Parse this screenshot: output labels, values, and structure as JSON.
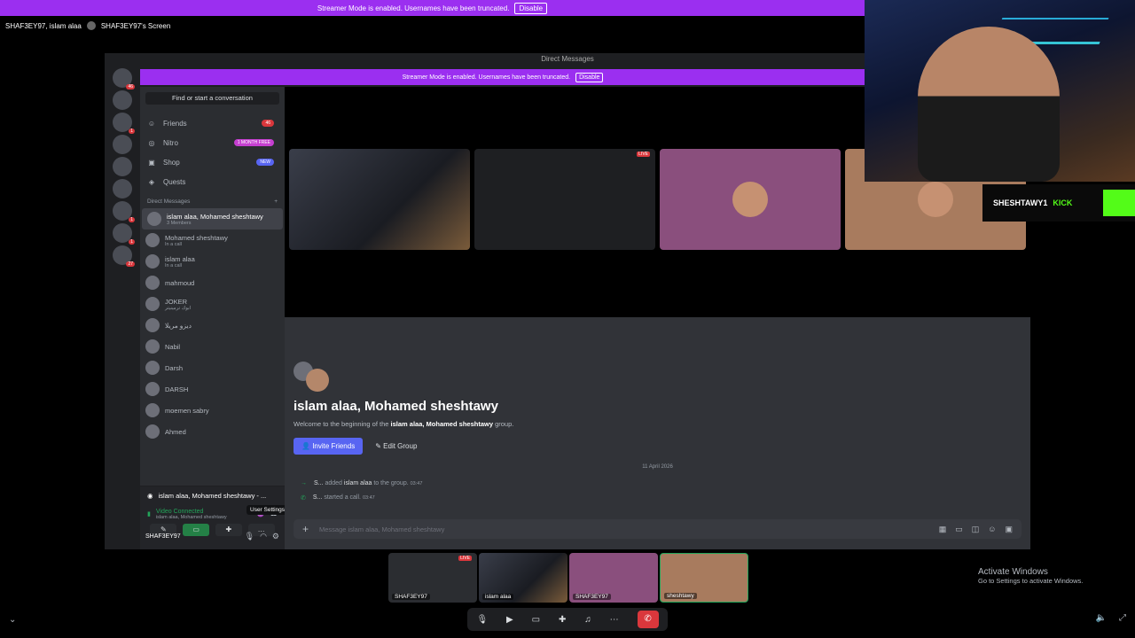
{
  "top_banner": {
    "text": "Streamer Mode is enabled. Usernames have been truncated.",
    "button": "Disable"
  },
  "call_title": {
    "participants": "SHAF3EY97, islam alaa",
    "screen": "SHAF3EY97's Screen"
  },
  "window": {
    "title": "Direct Messages"
  },
  "inner_banner": {
    "text": "Streamer Mode is enabled. Usernames have been truncated.",
    "button": "Disable"
  },
  "guild_badges": [
    "46",
    "",
    "1",
    "",
    "",
    "",
    "1",
    "1",
    "27"
  ],
  "dm_panel": {
    "search": "Find or start a conversation",
    "nav": [
      {
        "icon": "friends-icon",
        "glyph": "☺",
        "label": "Friends",
        "pill": "46",
        "pill_color": "#da373c"
      },
      {
        "icon": "nitro-icon",
        "glyph": "◎",
        "label": "Nitro",
        "pill": "1 MONTH FREE",
        "pill_color": "#c53fd0"
      },
      {
        "icon": "shop-icon",
        "glyph": "▣",
        "label": "Shop",
        "pill": "NEW",
        "pill_color": "#5865f2"
      },
      {
        "icon": "quests-icon",
        "glyph": "◈",
        "label": "Quests",
        "pill": "",
        "pill_color": ""
      }
    ],
    "dm_heading": "Direct Messages",
    "dm_add": "+",
    "dms": [
      {
        "name": "islam alaa, Mohamed sheshtawy",
        "sub": "3 Members"
      },
      {
        "name": "Mohamed sheshtawy",
        "sub": "In a call"
      },
      {
        "name": "islam alaa",
        "sub": "In a call"
      },
      {
        "name": "mahmoud",
        "sub": ""
      },
      {
        "name": "JOKER",
        "sub": "ابوك ترمينيتر"
      },
      {
        "name": "ديزو مريلا",
        "sub": ""
      },
      {
        "name": "Nabil",
        "sub": ""
      },
      {
        "name": "Darsh",
        "sub": ""
      },
      {
        "name": "DARSH",
        "sub": ""
      },
      {
        "name": "moemen sabry",
        "sub": ""
      },
      {
        "name": "Ahmed",
        "sub": ""
      }
    ]
  },
  "voice_panel": {
    "call_name": "islam alaa, Mohamed sheshtawy - ...",
    "status": "Video Connected",
    "status_sub": "islam alaa, Mohamed sheshtawy",
    "tooltip": "User Settings",
    "user": "SHAF3EY97"
  },
  "stage": {
    "live_badge": "LIVE"
  },
  "chat": {
    "title": "islam alaa, Mohamed sheshtawy",
    "desc_prefix": "Welcome to the beginning of the",
    "desc_group": "islam alaa, Mohamed sheshtawy",
    "desc_suffix": "group.",
    "invite_label": "Invite Friends",
    "edit_label": "Edit Group",
    "date": "11 April 2026",
    "messages": [
      {
        "user": "S...",
        "action": "added",
        "target": "islam alaa",
        "rest": "to the group.",
        "time": "03:47"
      },
      {
        "user": "S...",
        "action": "started a call.",
        "target": "",
        "rest": "",
        "time": "03:47"
      }
    ],
    "input_placeholder": "Message islam alaa, Mohamed sheshtawy"
  },
  "kick": {
    "text": "SHESHTAWY1",
    "brand": "KICK"
  },
  "thumbs": [
    {
      "label": "SHAF3EY97",
      "live": "LIVE"
    },
    {
      "label": "islam alaa",
      "live": ""
    },
    {
      "label": "SHAF3EY97",
      "live": ""
    },
    {
      "label": "sheshtawy",
      "live": ""
    }
  ],
  "activate": {
    "line1": "Activate Windows",
    "line2": "Go to Settings to activate Windows."
  }
}
